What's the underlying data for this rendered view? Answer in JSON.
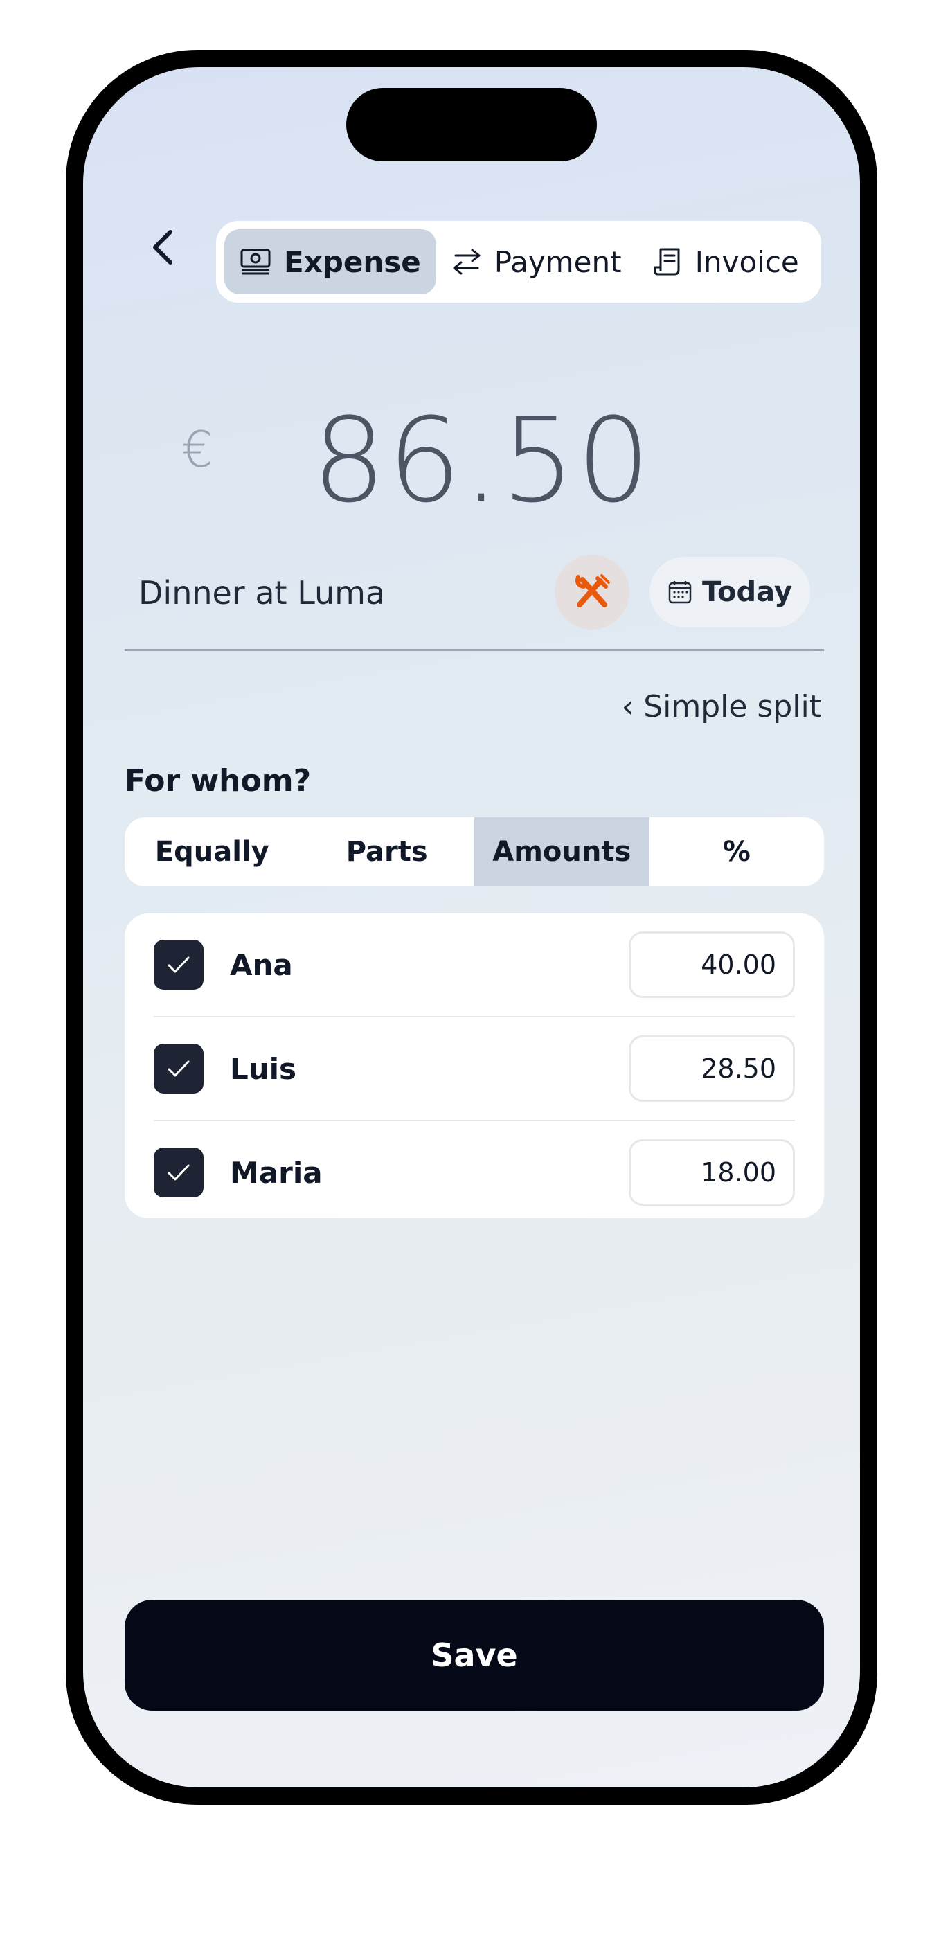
{
  "header": {
    "types": [
      {
        "label": "Expense",
        "icon": "banknote-icon",
        "active": true
      },
      {
        "label": "Payment",
        "icon": "arrows-swap-icon",
        "active": false
      },
      {
        "label": "Invoice",
        "icon": "receipt-icon",
        "active": false
      }
    ]
  },
  "amount": {
    "currency": "€",
    "value": "86.50"
  },
  "description": {
    "text": "Dinner at Luma",
    "category_icon": "fork-knife-icon",
    "date_label": "Today"
  },
  "split": {
    "toggle_label": "‹ Simple split",
    "section_label": "For whom?",
    "modes": [
      {
        "label": "Equally",
        "active": false
      },
      {
        "label": "Parts",
        "active": false
      },
      {
        "label": "Amounts",
        "active": true
      },
      {
        "label": "%",
        "active": false
      }
    ],
    "people": [
      {
        "name": "Ana",
        "checked": true,
        "amount": "40.00"
      },
      {
        "name": "Luis",
        "checked": true,
        "amount": "28.50"
      },
      {
        "name": "Maria",
        "checked": true,
        "amount": "18.00"
      }
    ]
  },
  "actions": {
    "save_label": "Save"
  },
  "colors": {
    "accent": "#e8590c",
    "button": "#050816",
    "active_segment": "#cbd5e1"
  }
}
